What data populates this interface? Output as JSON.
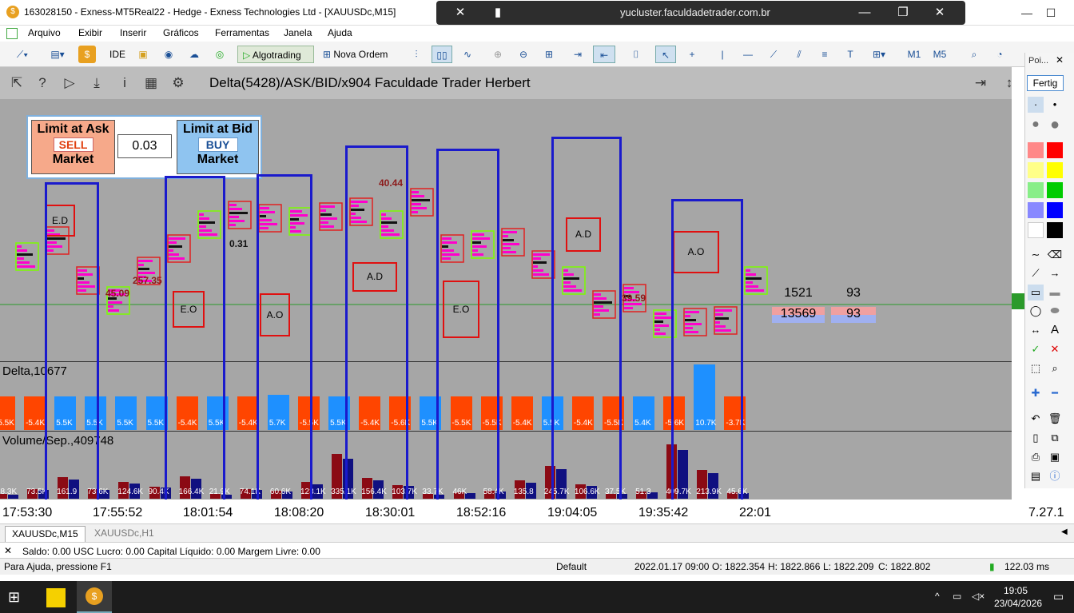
{
  "window": {
    "title": "163028150 - Exness-MT5Real22 - Hedge - Exness Technologies Ltd - [XAUUSDc,M15]",
    "remote_host": "yucluster.faculdadetrader.com.br"
  },
  "menu": [
    "Arquivo",
    "Exibir",
    "Inserir",
    "Gráficos",
    "Ferramentas",
    "Janela",
    "Ajuda"
  ],
  "toolbar": {
    "ide": "IDE",
    "algotrading": "Algotrading",
    "nova_ordem": "Nova Ordem",
    "m1": "M1",
    "m5": "M5",
    "notif_count": "1"
  },
  "indicator": {
    "title": "Delta(5428)/ASK/BID/x904   Faculdade Trader Herbert"
  },
  "trade_panel": {
    "sell_top": "Limit at Ask",
    "sell_mid": "SELL",
    "sell_bot": "Market",
    "lot": "0.03",
    "buy_top": "Limit at Bid",
    "buy_mid": "BUY",
    "buy_bot": "Market"
  },
  "annotations": {
    "ed": "E.D",
    "eo1": "E.O",
    "ao1": "A.O",
    "ad1": "A.D",
    "eo2": "E.O",
    "ad2": "A.D",
    "ao2": "A.O",
    "v1": "45.09",
    "v2": "257.35",
    "v3": "0.31",
    "v4": "40.44",
    "v5": "39.59"
  },
  "summary": {
    "a1": "1521",
    "a2": "93",
    "b1": "13569",
    "b2": "93"
  },
  "delta_panel": {
    "title": "Delta,10677",
    "values": [
      "-5.5K",
      "-5.4K",
      "5.5K",
      "5.5K",
      "5.5K",
      "5.5K",
      "-5.4K",
      "5.5K",
      "-5.4K",
      "5.7K",
      "-5.5K",
      "5.5K",
      "-5.4K",
      "-5.6K",
      "5.5K",
      "-5.5K",
      "-5.5K",
      "-5.4K",
      "5.5K",
      "-5.4K",
      "-5.5K",
      "5.4K",
      "-5.6K",
      "10.7K",
      "-3.7K"
    ],
    "colors": [
      "#ff4500",
      "#ff4500",
      "#1e90ff",
      "#1e90ff",
      "#1e90ff",
      "#1e90ff",
      "#ff4500",
      "#1e90ff",
      "#ff4500",
      "#1e90ff",
      "#ff4500",
      "#1e90ff",
      "#ff4500",
      "#ff4500",
      "#1e90ff",
      "#ff4500",
      "#ff4500",
      "#ff4500",
      "#1e90ff",
      "#ff4500",
      "#ff4500",
      "#1e90ff",
      "#ff4500",
      "#1e90ff",
      "#ff4500"
    ]
  },
  "volume_panel": {
    "title": "Volume/Sep.,409748",
    "labels": [
      "28.3K",
      "73.5K",
      "161.9",
      "73.6K",
      "124.6K",
      "90.4K",
      "166.4K",
      "21.9K",
      "74.1K",
      "60.6K",
      "123.1K",
      "335.1K",
      "156.4K",
      "103.7K",
      "33.7K",
      "46K",
      "58.4K",
      "135.8",
      "245.7K",
      "106.6K",
      "37.5K",
      "51.3",
      "409.7K",
      "213.9K",
      "45.6K"
    ]
  },
  "time_axis": [
    "17:53:30",
    "17:55:52",
    "18:01:54",
    "18:08:20",
    "18:30:01",
    "18:52:16",
    "19:04:05",
    "19:35:42",
    "22:01"
  ],
  "scale_right": "7.27.1",
  "tabs": [
    "XAUUSDc,M15",
    "XAUUSDc,H1"
  ],
  "balance": "Saldo: 0.00 USC  Lucro: 0.00  Capital Líquido: 0.00  Margem Livre: 0.00",
  "status": {
    "help": "Para Ajuda, pressione F1",
    "profile": "Default",
    "datetime": "2022.01.17 09:00",
    "o": "O: 1822.354",
    "h": "H: 1822.866",
    "l": "L: 1822.209",
    "c": "C: 1822.802",
    "ping": "122.03 ms"
  },
  "palette": {
    "title": "Poi...",
    "fertig": "Fertig"
  },
  "taskbar": {
    "time": "19:05",
    "date": "23/04/2026"
  }
}
